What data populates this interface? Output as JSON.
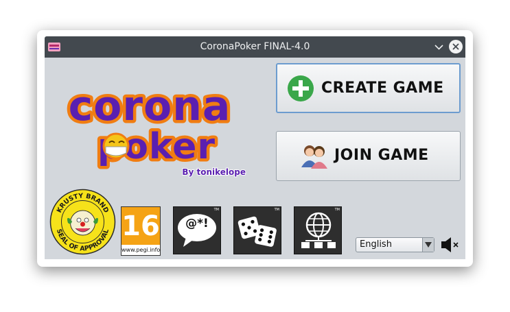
{
  "window": {
    "title": "CoronaPoker FINAL-4.0"
  },
  "logo": {
    "line1": "corona",
    "line2": "poker",
    "credit": "By tonikelope"
  },
  "buttons": {
    "create": "CREATE GAME",
    "join": "JOIN GAME"
  },
  "badges": {
    "krusty_top": "KRUSTY BRAND",
    "krusty_bottom": "SEAL OF APPROVAL",
    "pegi_age": "16",
    "pegi_site": "www.pegi.info",
    "language_symbol": "@*!",
    "tm": "TM"
  },
  "language": {
    "selected": "English"
  },
  "colors": {
    "titlebar": "#43494f",
    "window_bg": "#d3d7dc",
    "accent_green": "#3aa74a",
    "logo_purple": "#5a1fb0",
    "logo_orange": "#f07d12",
    "focus_blue": "#6c9ccf"
  },
  "icons": [
    "app-icon",
    "minimize-icon",
    "close-icon",
    "plus-icon",
    "users-icon",
    "krusty-seal-icon",
    "pegi-16-icon",
    "bad-language-icon",
    "gambling-icon",
    "online-icon",
    "speaker-muted-icon",
    "dropdown-arrow-icon"
  ]
}
